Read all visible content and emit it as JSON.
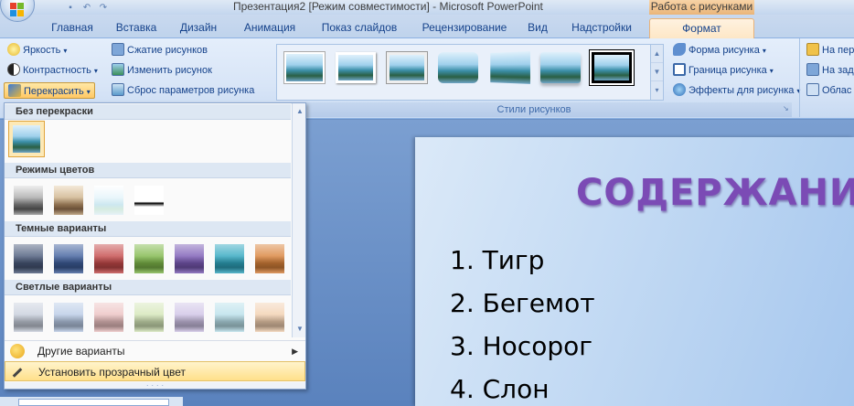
{
  "window": {
    "title": "Презентация2 [Режим совместимости] - Microsoft PowerPoint",
    "context_tab_group": "Работа с рисунками"
  },
  "tabs": [
    "Главная",
    "Вставка",
    "Дизайн",
    "Анимация",
    "Показ слайдов",
    "Рецензирование",
    "Вид",
    "Надстройки",
    "Формат"
  ],
  "active_tab": "Формат",
  "ribbon": {
    "adjust": {
      "brightness": "Яркость",
      "contrast": "Контрастность",
      "recolor": "Перекрасить",
      "compress": "Сжатие рисунков",
      "change_picture": "Изменить рисунок",
      "reset_picture": "Сброс параметров рисунка"
    },
    "picture_styles": {
      "group_label": "Стили рисунков",
      "shape": "Форма рисунка",
      "border": "Граница рисунка",
      "effects": "Эффекты для рисунка"
    },
    "arrange": {
      "bring_front": "На пер",
      "send_back": "На зад",
      "selection_pane": "Облас"
    }
  },
  "recolor_menu": {
    "sections": {
      "no_recolor": "Без перекраски",
      "color_modes": "Режимы цветов",
      "dark_variations": "Темные варианты",
      "light_variations": "Светлые варианты"
    },
    "color_mode_swatches": [
      "grayscale",
      "sepia",
      "washout",
      "black-and-white"
    ],
    "dark_colors": [
      "#4a5a7a",
      "#3f5f9c",
      "#c54a4a",
      "#7fb84a",
      "#7a5ab5",
      "#2fa6bf",
      "#d9823a"
    ],
    "light_colors": [
      "#c8cfdc",
      "#b9cbe6",
      "#ecc2c2",
      "#d4e6b8",
      "#cfc3e6",
      "#b9e0ea",
      "#f2d0b0"
    ],
    "more_variations": "Другие варианты",
    "set_transparent": "Установить прозрачный цвет"
  },
  "slide": {
    "title": "СОДЕРЖАНИЕ",
    "items": [
      "1. Тигр",
      "2. Бегемот",
      "3. Носорог",
      "4. Слон"
    ]
  }
}
